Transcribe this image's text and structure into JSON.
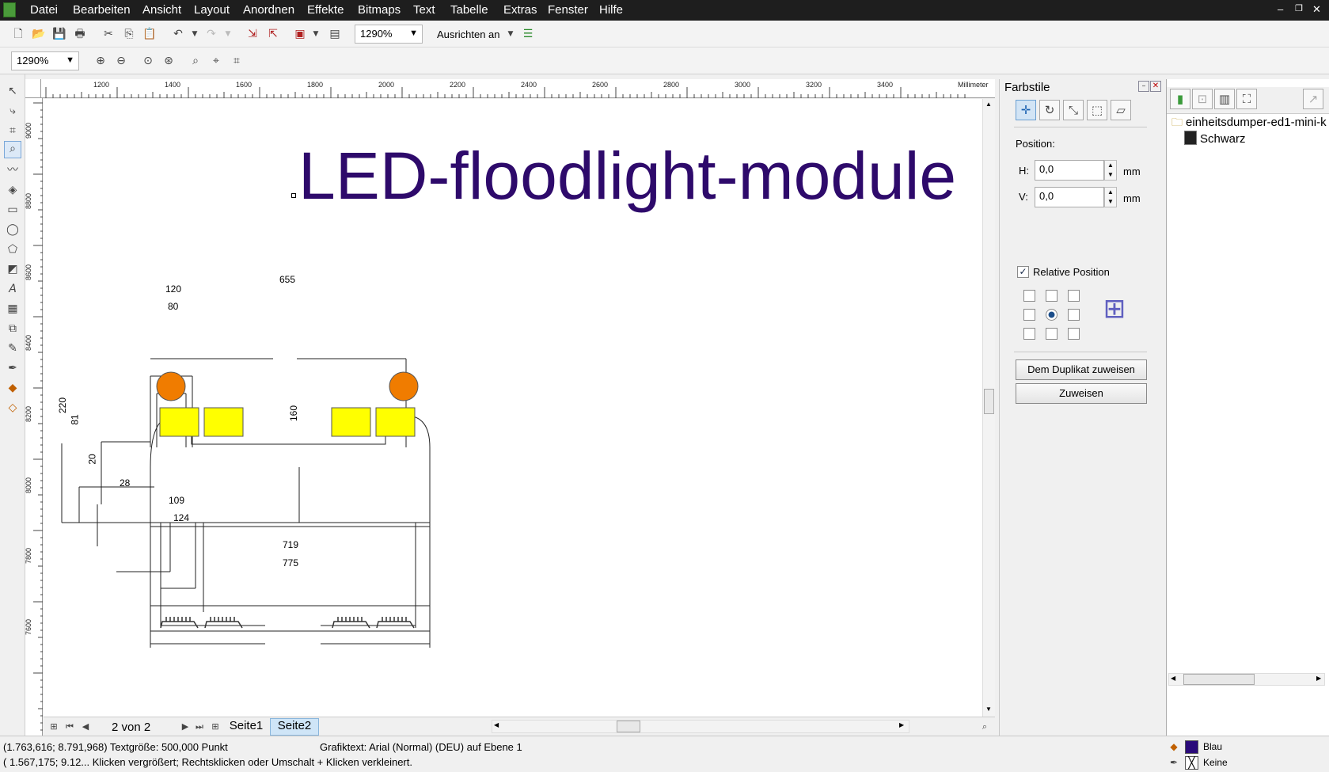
{
  "menu": [
    "Datei",
    "Bearbeiten",
    "Ansicht",
    "Layout",
    "Anordnen",
    "Effekte",
    "Bitmaps",
    "Text",
    "Tabelle",
    "Extras",
    "Fenster",
    "Hilfe"
  ],
  "toolbar": {
    "zoom_value": "1290%",
    "snap_label": "Ausrichten an"
  },
  "toolbar2": {
    "zoom_value": "1290%"
  },
  "ruler": {
    "unit": "Millimeter",
    "h_ticks": [
      "1200",
      "1400",
      "1600",
      "1800",
      "2000",
      "2200",
      "2400",
      "2600",
      "2800",
      "3000",
      "3200",
      "3400"
    ],
    "v_ticks": [
      "9000",
      "8800",
      "8600",
      "8400",
      "8200",
      "8000",
      "7800",
      "7600"
    ]
  },
  "canvas": {
    "title": "LED-floodlight-module",
    "dims": {
      "d655": "655",
      "d120": "120",
      "d80": "80",
      "d220": "220",
      "d81": "81",
      "d20": "20",
      "d160": "160",
      "d28": "28",
      "d109": "109",
      "d124": "124",
      "d719": "719",
      "d775": "775"
    },
    "colors": {
      "title": "#2e0a6b",
      "circle": "#f07c00",
      "led": "#ffff00"
    }
  },
  "pages": {
    "counter": "2 von 2",
    "tabs": [
      "Seite1",
      "Seite2"
    ]
  },
  "panel": {
    "title": "Farbstile",
    "position_label": "Position:",
    "h_label": "H:",
    "h_value": "0,0",
    "h_unit": "mm",
    "v_label": "V:",
    "v_value": "0,0",
    "v_unit": "mm",
    "relative_label": "Relative Position",
    "btn_duplicate": "Dem Duplikat zuweisen",
    "btn_assign": "Zuweisen"
  },
  "tree": {
    "root": "einheitsdumper-ed1-mini-k",
    "child": "Schwarz"
  },
  "status": {
    "line1": "(1.763,616; 8.791,968)  Textgröße: 500,000 Punkt",
    "object": "Grafiktext: Arial (Normal) (DEU) auf Ebene 1",
    "line2": "( 1.567,175; 9.12... Klicken vergrößert; Rechtsklicken oder Umschalt + Klicken verkleinert.",
    "fill_label": "Blau",
    "fill_color": "#2a0a7a",
    "outline_label": "Keine"
  }
}
